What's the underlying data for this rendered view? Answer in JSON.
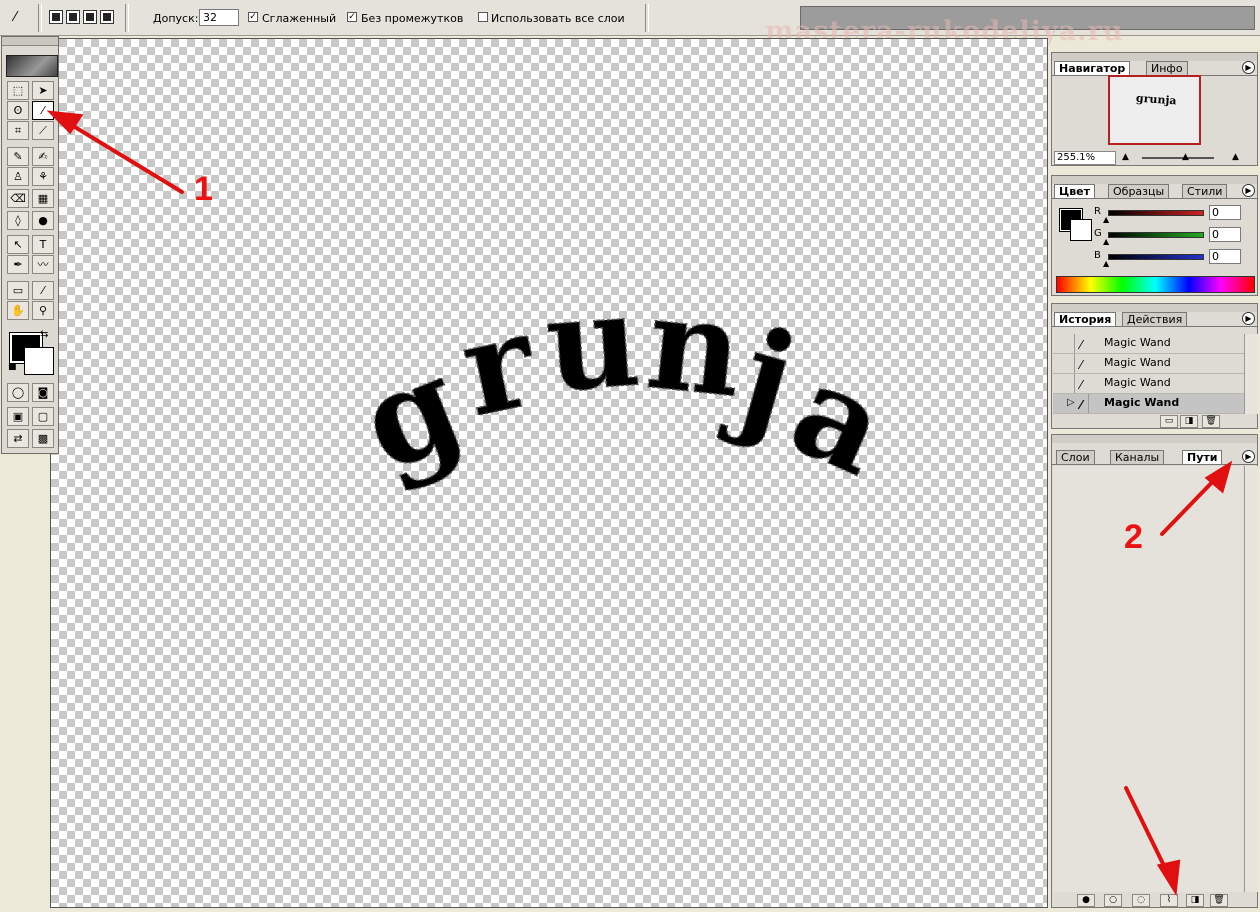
{
  "options_bar": {
    "tolerance_label": "Допуск:",
    "tolerance_value": "32",
    "anti_alias_label": "Сглаженный",
    "anti_alias_checked": true,
    "contiguous_label": "Без промежутков",
    "contiguous_checked": true,
    "all_layers_label": "Использовать все слои",
    "all_layers_checked": false,
    "watermark": "mastera-rukodeliya.ru"
  },
  "canvas": {
    "text": "grunja",
    "letters": [
      "g",
      "r",
      "u",
      "n",
      "j",
      "a"
    ]
  },
  "toolbox": {
    "tools": [
      {
        "name": "marquee-tool",
        "glyph": "⬚"
      },
      {
        "name": "move-tool",
        "glyph": "➤"
      },
      {
        "name": "lasso-tool",
        "glyph": "ʘ"
      },
      {
        "name": "magic-wand-tool",
        "glyph": "⁄"
      },
      {
        "name": "crop-tool",
        "glyph": "⌗"
      },
      {
        "name": "slice-tool",
        "glyph": "⟋"
      },
      {
        "name": "healing-brush-tool",
        "glyph": "✎"
      },
      {
        "name": "brush-tool",
        "glyph": "✍"
      },
      {
        "name": "clone-stamp-tool",
        "glyph": "♙"
      },
      {
        "name": "history-brush-tool",
        "glyph": "⚘"
      },
      {
        "name": "eraser-tool",
        "glyph": "⌫"
      },
      {
        "name": "gradient-tool",
        "glyph": "▦"
      },
      {
        "name": "blur-tool",
        "glyph": "◊"
      },
      {
        "name": "dodge-tool",
        "glyph": "●"
      },
      {
        "name": "path-selection-tool",
        "glyph": "↖"
      },
      {
        "name": "type-tool",
        "glyph": "T"
      },
      {
        "name": "pen-tool",
        "glyph": "✒"
      },
      {
        "name": "shape-tool",
        "glyph": "〰"
      },
      {
        "name": "notes-tool",
        "glyph": "▭"
      },
      {
        "name": "eyedropper-tool",
        "glyph": "⁄"
      },
      {
        "name": "hand-tool",
        "glyph": "✋"
      },
      {
        "name": "zoom-tool",
        "glyph": "⚲"
      },
      {
        "name": "standard-mode",
        "glyph": "◯"
      },
      {
        "name": "quick-mask-mode",
        "glyph": "◙"
      },
      {
        "name": "screen-mode",
        "glyph": "▣"
      },
      {
        "name": "screen-mode-full",
        "glyph": "▢"
      },
      {
        "name": "jump-to-imageready",
        "glyph": "⇄"
      },
      {
        "name": "extra-tool",
        "glyph": "▩"
      }
    ]
  },
  "navigator": {
    "tabs": [
      "Навигатор",
      "Инфо"
    ],
    "zoom": "255.1%",
    "preview_text": "grunja"
  },
  "color": {
    "tabs": [
      "Цвет",
      "Образцы",
      "Стили"
    ],
    "channels": [
      {
        "label": "R",
        "value": "0",
        "color": "#cc2222"
      },
      {
        "label": "G",
        "value": "0",
        "color": "#22aa22"
      },
      {
        "label": "B",
        "value": "0",
        "color": "#2233cc"
      }
    ]
  },
  "history": {
    "tabs": [
      "История",
      "Действия"
    ],
    "items": [
      {
        "label": "Magic Wand",
        "active": false
      },
      {
        "label": "Magic Wand",
        "active": false
      },
      {
        "label": "Magic Wand",
        "active": false
      },
      {
        "label": "Magic Wand",
        "active": true
      }
    ]
  },
  "layers": {
    "tabs": [
      "Слои",
      "Каналы",
      "Пути"
    ]
  },
  "annotations": {
    "label_1": "1",
    "label_2": "2",
    "arrow_color": "#e01010"
  }
}
